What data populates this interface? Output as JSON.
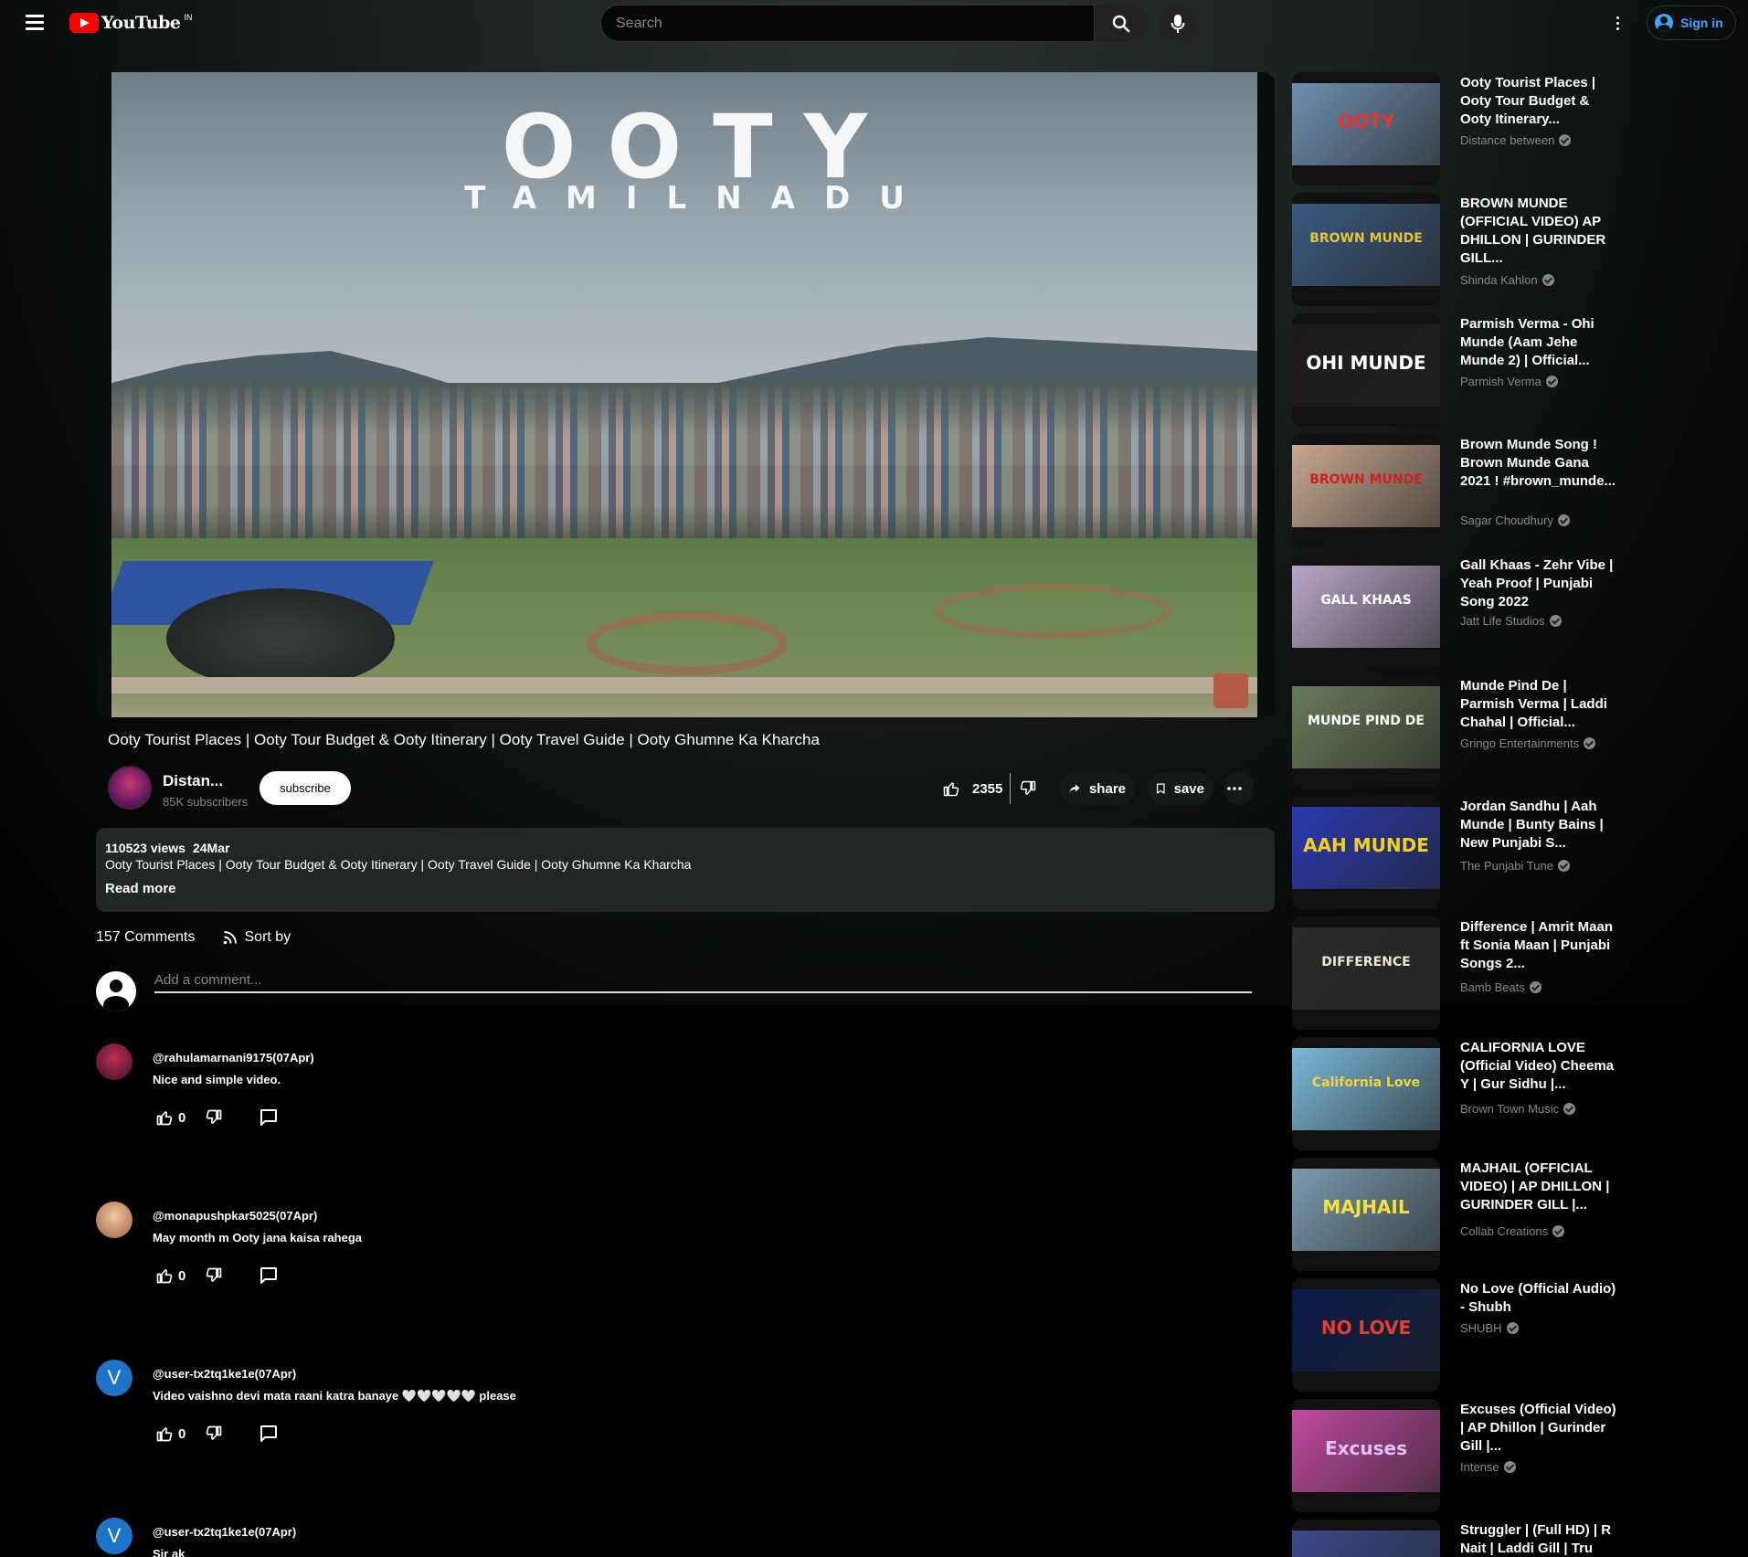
{
  "header": {
    "logo_text": "YouTube",
    "country_code": "IN",
    "search_placeholder": "Search",
    "signin_label": "Sign in"
  },
  "player": {
    "overlay_title": "OOTY",
    "overlay_subtitle": "TAMILNADU"
  },
  "video": {
    "title": "Ooty Tourist Places | Ooty Tour Budget & Ooty Itinerary | Ooty Travel Guide | Ooty Ghumne Ka Kharcha",
    "channel_name": "Distan...",
    "subscribers": "85K  subscribers",
    "subscribe_label": "subscribe",
    "likes": "2355",
    "share_label": "share",
    "save_label": "save"
  },
  "description": {
    "views": "110523 views",
    "date": "24Mar",
    "text": "Ooty Tourist Places | Ooty Tour Budget & Ooty Itinerary | Ooty Travel Guide | Ooty Ghumne Ka Kharcha",
    "read_more": "Read more"
  },
  "comments": {
    "count_label": "157 Comments",
    "sort_label": "Sort by",
    "input_placeholder": "Add a comment...",
    "items": [
      {
        "author": "@rahulamarnani9175(07Apr)",
        "text": "Nice and simple video.",
        "likes": "0",
        "avatar_color": "#5a2a3a",
        "avatar_letter": ""
      },
      {
        "author": "@monapushpkar5025(07Apr)",
        "text": "May month m Ooty jana kaisa rahega",
        "likes": "0",
        "avatar_color": "#c9906a",
        "avatar_letter": ""
      },
      {
        "author": "@user-tx2tq1ke1e(07Apr)",
        "text": "Video vaishno devi mata raani katra banaye 🤍🤍🤍🤍🤍 please",
        "likes": "0",
        "avatar_color": "#1e74c8",
        "avatar_letter": "V"
      },
      {
        "author": "@user-tx2tq1ke1e(07Apr)",
        "text": "Sir ak",
        "likes": "",
        "avatar_color": "#1e74c8",
        "avatar_letter": "V"
      }
    ]
  },
  "recommendations": [
    {
      "title": "Ooty Tourist Places | Ooty Tour Budget & Ooty Itinerary...",
      "channel": "Distance between",
      "thumb_text": "OOTY",
      "thumb_bg": "#6f8fb0",
      "thumb_fg": "#e8342c"
    },
    {
      "title": "BROWN MUNDE (OFFICIAL VIDEO) AP DHILLON | GURINDER GILL...",
      "channel": "Shinda Kahlon",
      "thumb_text": "BROWN MUNDE",
      "thumb_bg": "#3a5a80",
      "thumb_fg": "#e8c23a"
    },
    {
      "title": "Parmish Verma - Ohi Munde (Aam Jehe Munde 2) | Official...",
      "channel": "Parmish Verma",
      "thumb_text": "OHI MUNDE",
      "thumb_bg": "#1c1a1a",
      "thumb_fg": "#ffffff"
    },
    {
      "title": "Brown Munde Song ! Brown Munde Gana 2021 ! #brown_munde...",
      "channel": "Sagar Choudhury",
      "thumb_text": "BROWN MUNDE",
      "thumb_bg": "#c8a890",
      "thumb_fg": "#d02020"
    },
    {
      "title": "Gall Khaas - Zehr Vibe | Yeah Proof | Punjabi Song 2022",
      "channel": "Jatt Life Studios",
      "thumb_text": "GALL KHAAS",
      "thumb_bg": "#b9a6c8",
      "thumb_fg": "#ffffff"
    },
    {
      "title": "Munde Pind De | Parmish Verma | Laddi Chahal | Official...",
      "channel": "Gringo Entertainments",
      "thumb_text": "MUNDE PIND DE",
      "thumb_bg": "#6a7a5a",
      "thumb_fg": "#ffffff"
    },
    {
      "title": "Jordan Sandhu | Aah Munde | Bunty Bains | New Punjabi S...",
      "channel": "The Punjabi Tune",
      "thumb_text": "AAH MUNDE",
      "thumb_bg": "#2a3ab0",
      "thumb_fg": "#f5d21a"
    },
    {
      "title": "Difference | Amrit Maan ft Sonia Maan | Punjabi Songs 2...",
      "channel": "Bamb Beats",
      "thumb_text": "DIFFERENCE",
      "thumb_bg": "#2a2a2a",
      "thumb_fg": "#f0e6d0"
    },
    {
      "title": "CALIFORNIA LOVE (Official Video) Cheema Y | Gur Sidhu |...",
      "channel": "Brown Town Music",
      "thumb_text": "California Love",
      "thumb_bg": "#7ab8d8",
      "thumb_fg": "#f5d23a"
    },
    {
      "title": "MAJHAIL (OFFICIAL VIDEO) | AP DHILLON | GURINDER GILL |...",
      "channel": "Collab Creations",
      "thumb_text": "MAJHAIL",
      "thumb_bg": "#7a9ab0",
      "thumb_fg": "#f5e23a"
    },
    {
      "title": "No Love (Official Audio) - Shubh",
      "channel": "SHUBH",
      "thumb_text": "NO LOVE",
      "thumb_bg": "#0a1a4a",
      "thumb_fg": "#e04030"
    },
    {
      "title": "Excuses (Official Video) | AP Dhillon | Gurinder Gill |...",
      "channel": "Intense",
      "thumb_text": "Excuses",
      "thumb_bg": "#c04aa0",
      "thumb_fg": "#e0c0ff"
    },
    {
      "title": "Struggler | (Full HD) | R Nait | Laddi Gill | Tru",
      "channel": "",
      "thumb_text": "",
      "thumb_bg": "#3a4a8a",
      "thumb_fg": "#ffffff"
    }
  ]
}
